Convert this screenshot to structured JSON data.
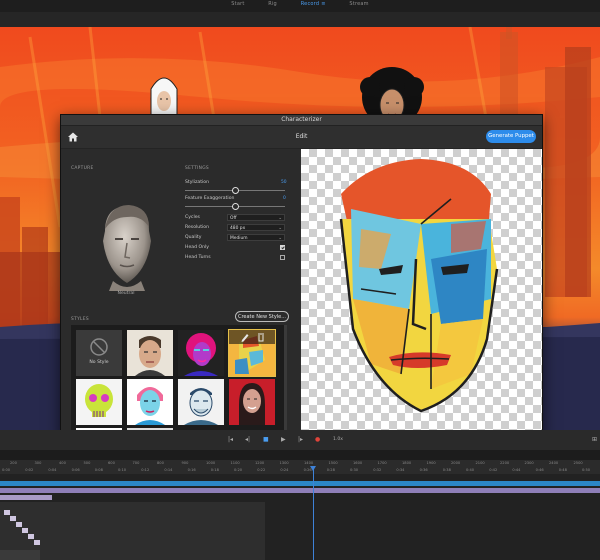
{
  "app": {
    "top_tabs": [
      {
        "label": "Start",
        "active": false
      },
      {
        "label": "Rig",
        "active": false
      },
      {
        "label": "Record",
        "active": true
      },
      {
        "label": "Stream",
        "active": false
      }
    ]
  },
  "dialog": {
    "title": "Characterizer",
    "toolbar": {
      "home_icon": "home-icon",
      "mode_label": "Edit",
      "generate_label": "Generate Puppet"
    },
    "capture": {
      "section_label": "CAPTURE",
      "pose_label": "Neutral"
    },
    "settings": {
      "section_label": "SETTINGS",
      "stylization": {
        "label": "Stylization",
        "value": "50",
        "level": 0.5
      },
      "feature_exaggeration": {
        "label": "Feature Exaggeration",
        "value": "0",
        "level": 0.5
      },
      "cycles": {
        "label": "Cycles",
        "value": "Off"
      },
      "resolution": {
        "label": "Resolution",
        "value": "480 px"
      },
      "quality": {
        "label": "Quality",
        "value": "Medium"
      },
      "head_only": {
        "label": "Head Only",
        "checked": true
      },
      "head_turns": {
        "label": "Head Turns",
        "checked": false
      }
    },
    "styles": {
      "section_label": "STYLES",
      "create_label": "Create New Style...",
      "no_style_label": "No Style"
    }
  },
  "playback": {
    "rate": "1.0x"
  },
  "timeline": {
    "ruler_top": [
      "200",
      "300",
      "400",
      "500",
      "600",
      "700",
      "800",
      "900",
      "1000",
      "1100",
      "1200",
      "1300",
      "1400",
      "1500",
      "1600",
      "1700",
      "1800",
      "1900",
      "2000",
      "2100",
      "2200",
      "2300",
      "2400",
      "2500"
    ],
    "ruler_bottom": [
      "0:00",
      "0:02",
      "0:04",
      "0:06",
      "0:08",
      "0:10",
      "0:12",
      "0:14",
      "0:16",
      "0:18",
      "0:20",
      "0:22",
      "0:24",
      "0:26",
      "0:28",
      "0:30",
      "0:32",
      "0:34",
      "0:36",
      "0:38",
      "0:40",
      "0:42",
      "0:44",
      "0:46",
      "0:48",
      "0:50"
    ]
  },
  "colors": {
    "accent": "#2d8ceb",
    "playhead": "#3e82d8",
    "selection": "#e5c04a"
  }
}
